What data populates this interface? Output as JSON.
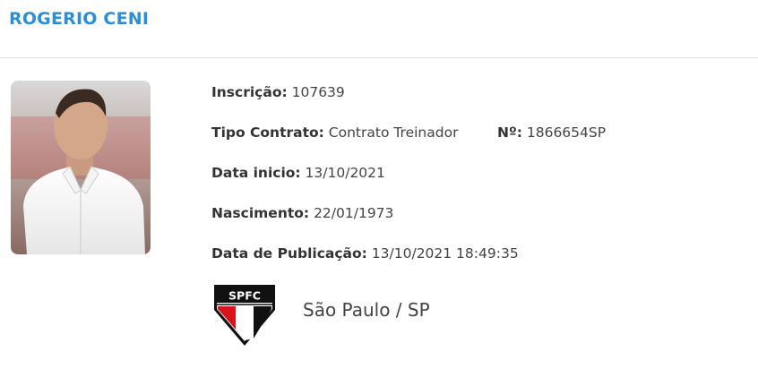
{
  "profile": {
    "name": "ROGERIO CENI",
    "photo_alt": "coach-photo"
  },
  "details": {
    "inscricao_label": "Inscrição:",
    "inscricao_value": "107639",
    "tipo_label": "Tipo Contrato:",
    "tipo_value": "Contrato Treinador",
    "numero_label": "Nº:",
    "numero_value": "1866654SP",
    "data_inicio_label": "Data inicio:",
    "data_inicio_value": "13/10/2021",
    "nascimento_label": "Nascimento:",
    "nascimento_value": "22/01/1973",
    "publicacao_label": "Data de Publicação:",
    "publicacao_value": "13/10/2021 18:49:35"
  },
  "club": {
    "crest_text": "SPFC",
    "name": "São Paulo / SP",
    "colors": {
      "red": "#d8141c",
      "black": "#111111",
      "white": "#ffffff"
    }
  },
  "colors": {
    "accent": "#2a8fd6"
  }
}
